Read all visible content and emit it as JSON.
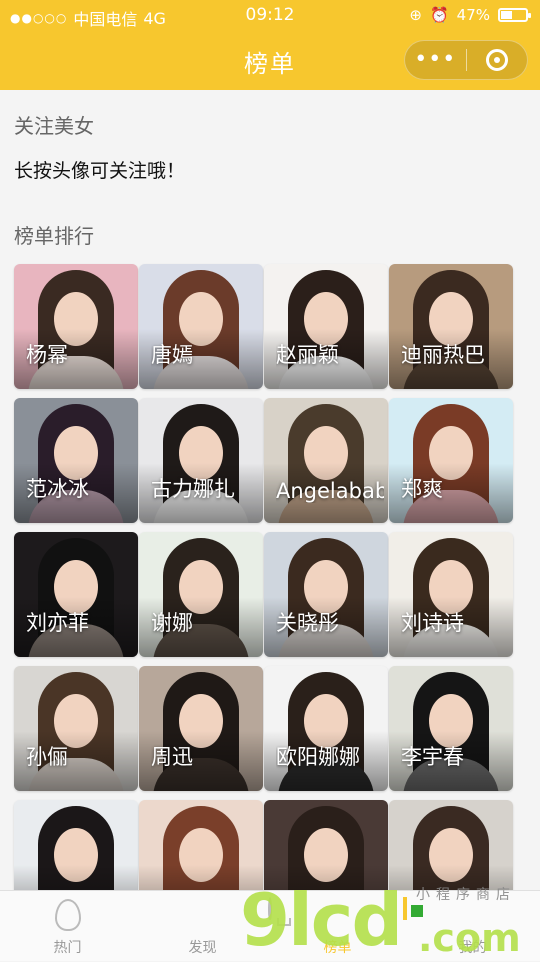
{
  "status_bar": {
    "signal": "●●○○○",
    "carrier": "中国电信",
    "network": "4G",
    "time": "09:12",
    "battery_percent": "47%",
    "battery_level": 0.47
  },
  "nav": {
    "title": "榜单",
    "more_label": "•••"
  },
  "follow_section": {
    "title": "关注美女",
    "hint": "长按头像可关注哦！"
  },
  "ranking_section": {
    "title": "榜单排行"
  },
  "cards": [
    {
      "name": "杨幂",
      "bg": "#e8b5bf",
      "hair": "#3a2a22",
      "cloth": "#f2e6e0"
    },
    {
      "name": "唐嫣",
      "bg": "#d9dde8",
      "hair": "#6b3b2a",
      "cloth": "#ece6e6"
    },
    {
      "name": "赵丽颖",
      "bg": "#f4f2f0",
      "hair": "#2b1f1a",
      "cloth": "#ffffff"
    },
    {
      "name": "迪丽热巴",
      "bg": "#b79b7e",
      "hair": "#3b2a20",
      "cloth": "#5a4636"
    },
    {
      "name": "范冰冰",
      "bg": "#8a9098",
      "hair": "#2a1d2a",
      "cloth": "#b49aa8"
    },
    {
      "name": "古力娜扎",
      "bg": "#e8e8ea",
      "hair": "#1f1a18",
      "cloth": "#f7f7f7"
    },
    {
      "name": "Angelabab",
      "bg": "#d8d2c8",
      "hair": "#4a3b2c",
      "cloth": "#c8a98e"
    },
    {
      "name": "郑爽",
      "bg": "#d4ecf4",
      "hair": "#7a3b26",
      "cloth": "#d7a4a8"
    },
    {
      "name": "刘亦菲",
      "bg": "#1d1a1c",
      "hair": "#111111",
      "cloth": "#8a7f78"
    },
    {
      "name": "谢娜",
      "bg": "#e8eee6",
      "hair": "#2a221c",
      "cloth": "#5e5248"
    },
    {
      "name": "关晓彤",
      "bg": "#cfd6de",
      "hair": "#3b2a1f",
      "cloth": "#d9d4d0"
    },
    {
      "name": "刘诗诗",
      "bg": "#f1eee8",
      "hair": "#3a2a1e",
      "cloth": "#f4f2ee"
    },
    {
      "name": "孙俪",
      "bg": "#d8d6d2",
      "hair": "#4a3526",
      "cloth": "#d7cfc8"
    },
    {
      "name": "周迅",
      "bg": "#b7a79a",
      "hair": "#1f1916",
      "cloth": "#3a302a"
    },
    {
      "name": "欧阳娜娜",
      "bg": "#f3f3f3",
      "hair": "#2a201a",
      "cloth": "#2b2b2b"
    },
    {
      "name": "李宇春",
      "bg": "#dfe0d8",
      "hair": "#151515",
      "cloth": "#6a6a6a"
    },
    {
      "name": "",
      "bg": "#e9ecef",
      "hair": "#1b1718",
      "cloth": "#6b7f9e"
    },
    {
      "name": "",
      "bg": "#ecd8cc",
      "hair": "#7a3f2a",
      "cloth": "#ead7cc"
    },
    {
      "name": "",
      "bg": "#4a3a36",
      "hair": "#2a1f1a",
      "cloth": "#222222"
    },
    {
      "name": "",
      "bg": "#d6d2cc",
      "hair": "#3a2a22",
      "cloth": "#f0f0ee"
    }
  ],
  "tabs": [
    {
      "label": "热门",
      "icon": "flame-icon",
      "active": false
    },
    {
      "label": "发现",
      "icon": "bulb-icon",
      "active": false
    },
    {
      "label": "榜单",
      "icon": "rank-icon",
      "active": true
    },
    {
      "label": "我的",
      "icon": "person-icon",
      "active": false
    }
  ],
  "watermark": {
    "number": "9lcd",
    "domain": ".com",
    "small": "小程序商店"
  },
  "colors": {
    "brand": "#f7c72e"
  }
}
